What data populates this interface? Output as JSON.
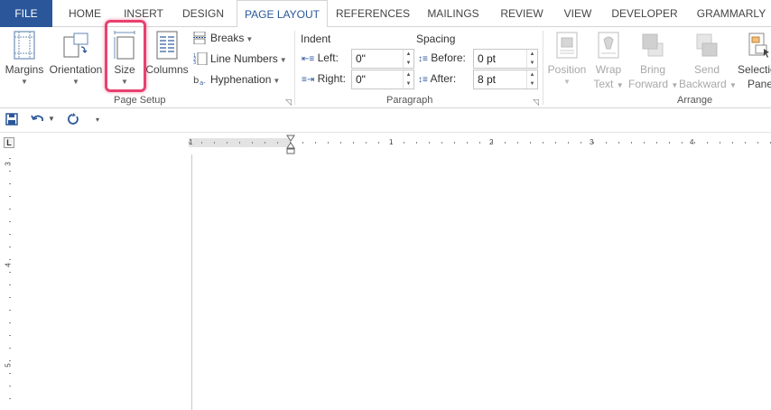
{
  "tabs": {
    "file": "FILE",
    "home": "HOME",
    "insert": "INSERT",
    "design": "DESIGN",
    "page_layout": "PAGE LAYOUT",
    "references": "REFERENCES",
    "mailings": "MAILINGS",
    "review": "REVIEW",
    "view": "VIEW",
    "developer": "DEVELOPER",
    "grammarly": "GRAMMARLY"
  },
  "page_setup": {
    "group_label": "Page Setup",
    "margins": "Margins",
    "orientation": "Orientation",
    "size": "Size",
    "columns": "Columns",
    "breaks": "Breaks",
    "line_numbers": "Line Numbers",
    "hyphenation": "Hyphenation"
  },
  "paragraph": {
    "group_label": "Paragraph",
    "indent_title": "Indent",
    "spacing_title": "Spacing",
    "left_label": "Left:",
    "left_value": "0\"",
    "right_label": "Right:",
    "right_value": "0\"",
    "before_label": "Before:",
    "before_value": "0 pt",
    "after_label": "After:",
    "after_value": "8 pt"
  },
  "arrange": {
    "group_label": "Arrange",
    "position": "Position",
    "wrap_1": "Wrap",
    "wrap_2": "Text",
    "bring_1": "Bring",
    "bring_2": "Forward",
    "send_1": "Send",
    "send_2": "Backward",
    "selection_1": "Selection",
    "selection_2": "Pane"
  },
  "ruler": {
    "corner": "L",
    "h_numbers": [
      "1",
      "1",
      "2",
      "3",
      "4"
    ],
    "v_numbers": [
      "3",
      "4",
      "5"
    ]
  },
  "colors": {
    "accent": "#2b579a",
    "highlight": "#e8416f"
  }
}
